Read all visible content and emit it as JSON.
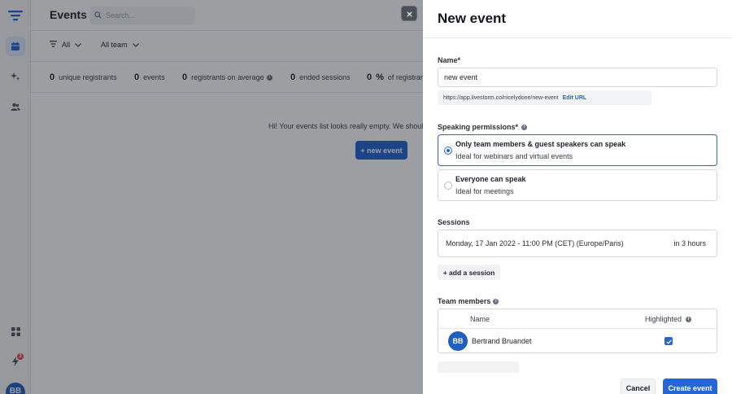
{
  "app": {
    "title": "Events",
    "search": {
      "placeholder": "Search..."
    },
    "filters": {
      "all": "All",
      "team": "All team"
    },
    "stats": [
      {
        "value": "0",
        "label": "unique registrants"
      },
      {
        "value": "0",
        "label": "events"
      },
      {
        "value": "0",
        "label": "registrants on average"
      },
      {
        "value": "0",
        "label": "ended sessions"
      },
      {
        "value": "0",
        "unit": "%",
        "label": "of registrants"
      }
    ],
    "empty_message": "Hi! Your events list looks really empty. We should",
    "new_event_button": "+ new event",
    "rail": {
      "notification_count": "3",
      "avatar_initials": "BB"
    }
  },
  "panel": {
    "title": "New event",
    "name_label": "Name*",
    "name_value": "new event",
    "url": "https://app.livestorm.co/nicelydone/new-event",
    "edit_url": "Edit URL",
    "speaking_label": "Speaking permissions*",
    "speaking_options": [
      {
        "title": "Only team members & guest speakers can speak",
        "desc": "Ideal for webinars and virtual events",
        "selected": true
      },
      {
        "title": "Everyone can speak",
        "desc": "Ideal for meetings",
        "selected": false
      }
    ],
    "sessions_label": "Sessions",
    "session": {
      "date": "Monday, 17 Jan 2022 - 11:00 PM (CET) (Europe/Paris)",
      "relative": "in 3 hours"
    },
    "add_session": "+ add a session",
    "team_label": "Team members",
    "team_columns": {
      "name": "Name",
      "highlighted": "Highlighted"
    },
    "members": [
      {
        "initials": "BB",
        "name": "Bertrand Bruandet",
        "highlighted": true
      }
    ],
    "cancel": "Cancel",
    "create": "Create event"
  },
  "colors": {
    "accent": "#2565d4",
    "avatar": "#1f5fbf",
    "overlay": "rgba(20,24,31,0.42)"
  },
  "icons": [
    "menu-icon",
    "calendar-icon",
    "sparkle-icon",
    "people-icon",
    "apps-icon",
    "bolt-icon",
    "search-icon",
    "filter-icon",
    "chevron-down-icon",
    "close-icon",
    "info-icon",
    "check-icon"
  ]
}
